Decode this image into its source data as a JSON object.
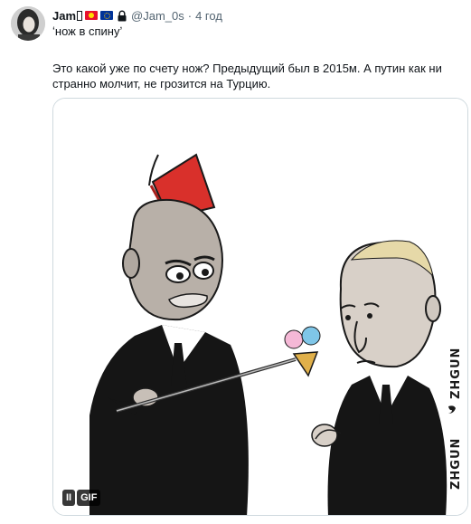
{
  "author": {
    "name": "Jam",
    "handle": "@Jam_0s",
    "separator": "·",
    "time": "4 год",
    "badges": [
      "kyrgyzstan-flag-icon",
      "eu-flag-icon",
      "lock-icon"
    ]
  },
  "tweet": {
    "quote": "ʻнож в спинуʼ",
    "text": "Это какой уже по счету нож? Предыдущий был в 2015м. А путин как ни странно молчит, не грозится на Турцию."
  },
  "media": {
    "type": "gif",
    "controls": {
      "pause_label": "II",
      "gif_label": "GIF"
    },
    "watermark": "ZHGUN"
  },
  "colors": {
    "text": "#0f1419",
    "secondary": "#536471",
    "border": "#cfd9de"
  }
}
